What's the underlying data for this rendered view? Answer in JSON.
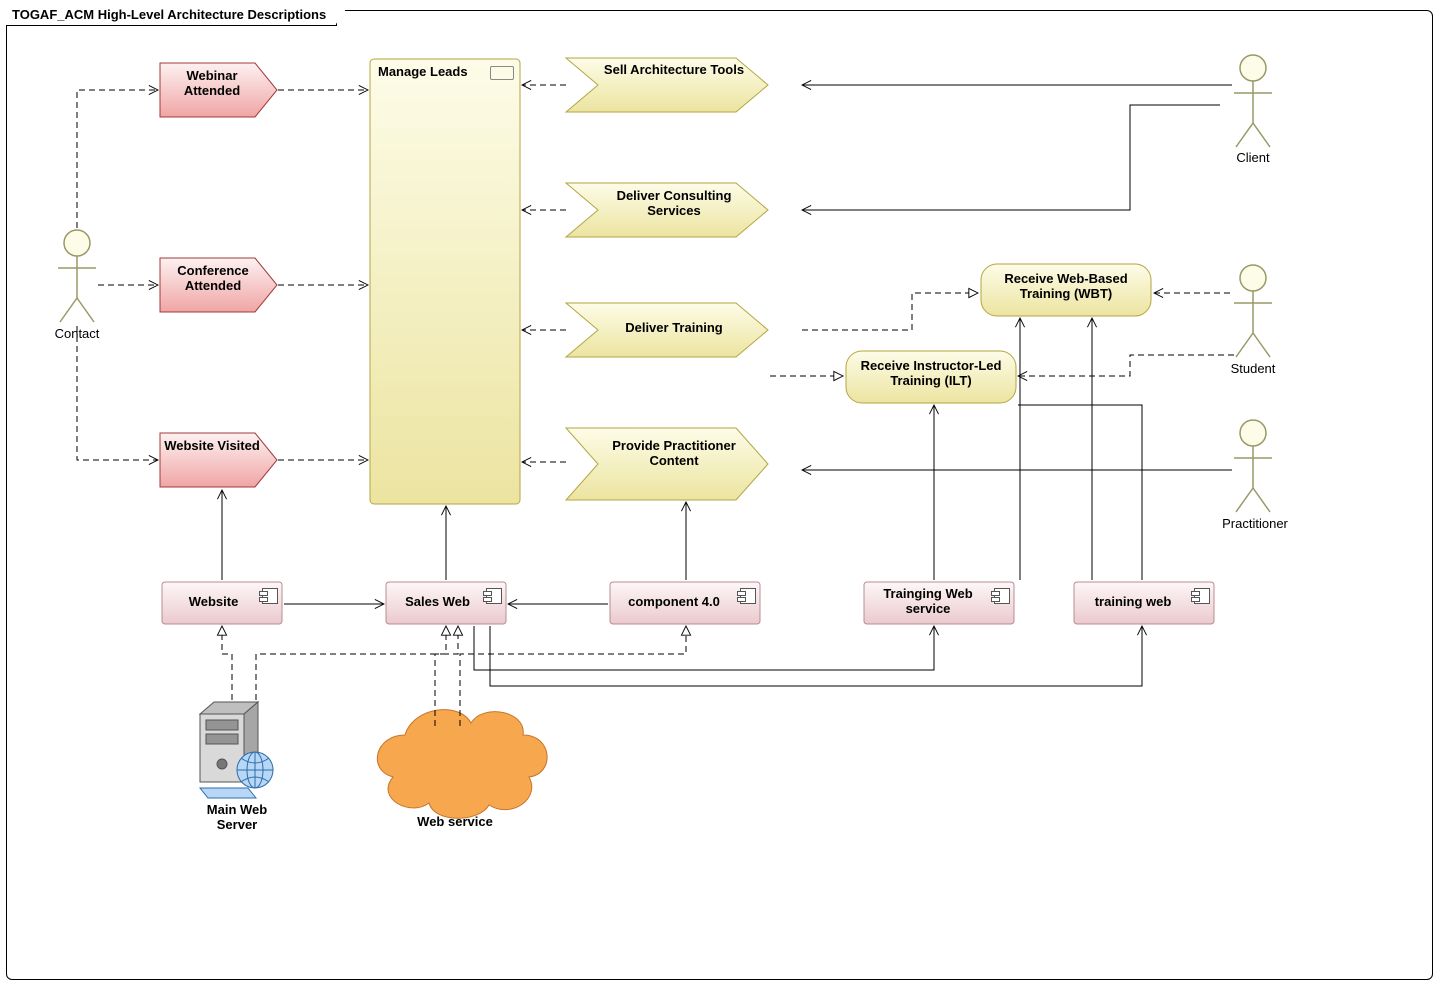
{
  "title": "TOGAF_ACM High-Level Architecture Descriptions",
  "actors": {
    "contact": "Contact",
    "client": "Client",
    "student": "Student",
    "practitioner": "Practitioner"
  },
  "triggers": {
    "webinar": "Webinar Attended",
    "conference": "Conference Attended",
    "website": "Website Visited"
  },
  "process": {
    "manage": "Manage Leads"
  },
  "goals": {
    "sell_tools": "Sell Architecture Tools",
    "consulting": "Deliver Consulting Services",
    "training": "Deliver Training",
    "content": "Provide Practitioner Content"
  },
  "subgoals": {
    "ilt": "Receive Instructor-Led Training (ILT)",
    "wbt": "Receive Web-Based Training (WBT)"
  },
  "components": {
    "website": "Website",
    "salesweb": "Sales Web",
    "comp40": "component 4.0",
    "trainsvc": "Trainging Web service",
    "trainweb": "training web"
  },
  "nodes": {
    "mainws": "Main Web Server",
    "websvc": "Web service"
  },
  "colors": {
    "trigger_fill": "#f6b8b8",
    "trigger_stroke": "#a03a3a",
    "goal_fill": "#f3efbd",
    "goal_stroke": "#b3a640",
    "comp_fill": "#f3dde0",
    "comp_stroke": "#b88c95",
    "cloud": "#f7a84f"
  }
}
